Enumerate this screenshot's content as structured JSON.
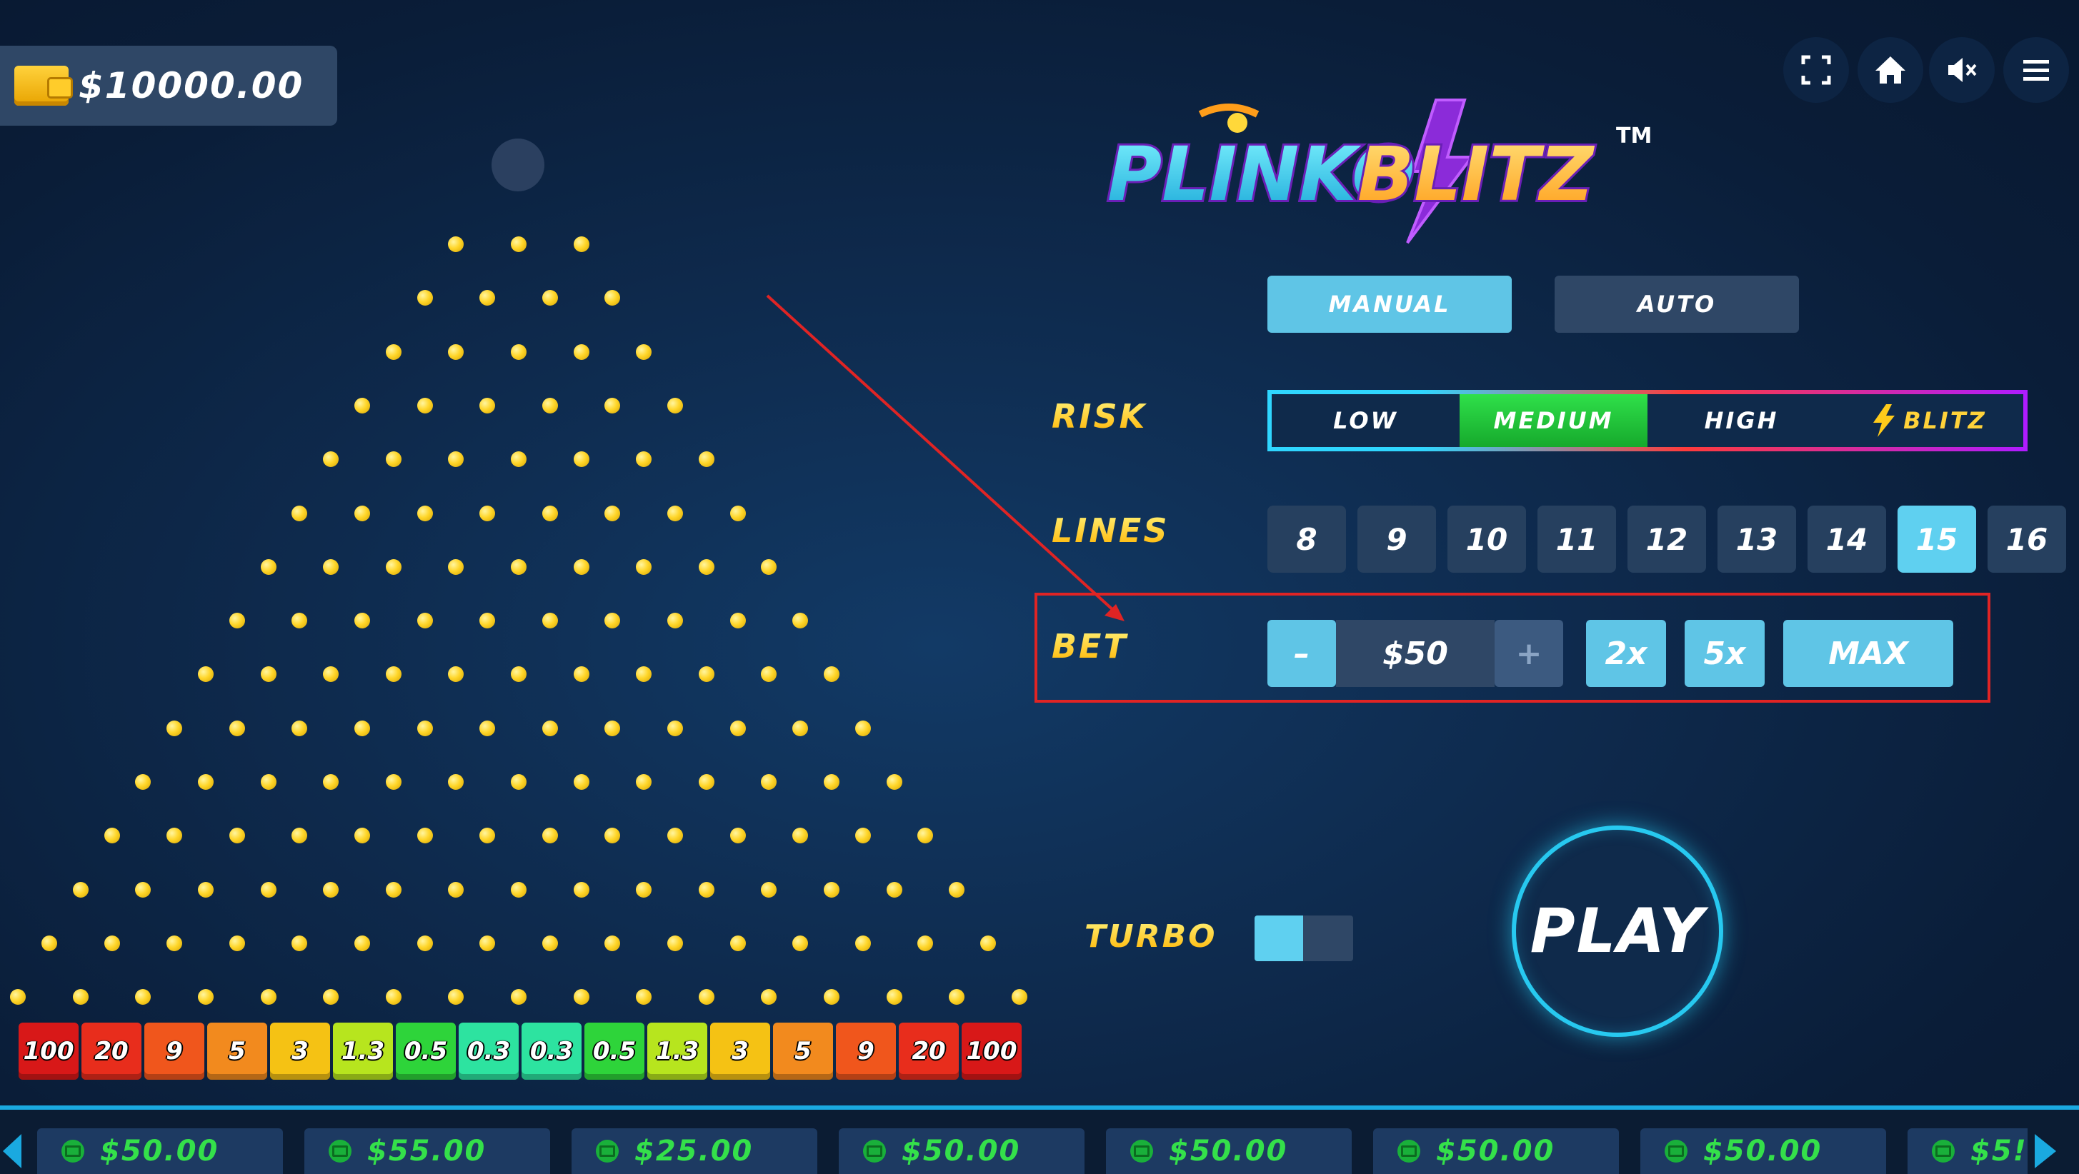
{
  "wallet": {
    "balance": "$10000.00",
    "icon": "wallet-icon"
  },
  "top_controls": [
    {
      "name": "fullscreen",
      "icon": "fullscreen-icon"
    },
    {
      "name": "home",
      "icon": "home-icon"
    },
    {
      "name": "mute",
      "icon": "speaker-muted-icon"
    },
    {
      "name": "menu",
      "icon": "hamburger-menu-icon"
    }
  ],
  "logo": {
    "text_part1": "PLINKO",
    "text_part2": "BLITZ",
    "trademark": "TM"
  },
  "modes": {
    "manual": "MANUAL",
    "auto": "AUTO",
    "selected": "MANUAL"
  },
  "risk": {
    "label": "RISK",
    "options": [
      "LOW",
      "MEDIUM",
      "HIGH",
      "BLITZ"
    ],
    "selected": "MEDIUM"
  },
  "lines": {
    "label": "LINES",
    "options": [
      "8",
      "9",
      "10",
      "11",
      "12",
      "13",
      "14",
      "15",
      "16"
    ],
    "selected": "15"
  },
  "bet": {
    "label": "BET",
    "minus": "–",
    "value": "$50",
    "plus": "+",
    "double": "2x",
    "five": "5x",
    "max": "MAX"
  },
  "turbo": {
    "label": "TURBO",
    "on": false
  },
  "play": {
    "label": "PLAY"
  },
  "board": {
    "rows": 15
  },
  "buckets": [
    {
      "label": "100",
      "color": "#d81818"
    },
    {
      "label": "20",
      "color": "#e82d1c"
    },
    {
      "label": "9",
      "color": "#f0561c"
    },
    {
      "label": "5",
      "color": "#f28a1e"
    },
    {
      "label": "3",
      "color": "#f5c214"
    },
    {
      "label": "1.3",
      "color": "#b7e51e"
    },
    {
      "label": "0.5",
      "color": "#2ed43a"
    },
    {
      "label": "0.3",
      "color": "#2de3a0"
    },
    {
      "label": "0.3",
      "color": "#2de3a0"
    },
    {
      "label": "0.5",
      "color": "#2ed43a"
    },
    {
      "label": "1.3",
      "color": "#b7e51e"
    },
    {
      "label": "3",
      "color": "#f5c214"
    },
    {
      "label": "5",
      "color": "#f28a1e"
    },
    {
      "label": "9",
      "color": "#f0561c"
    },
    {
      "label": "20",
      "color": "#e82d1c"
    },
    {
      "label": "100",
      "color": "#d81818"
    }
  ],
  "history": [
    "$50.00",
    "$55.00",
    "$25.00",
    "$50.00",
    "$50.00",
    "$50.00",
    "$50.00",
    "$5!"
  ],
  "colors": {
    "accent_cyan": "#5fd0f0",
    "selected_green": "#22c43a",
    "annotation_red": "#e02424",
    "win_green": "#34e04a"
  }
}
